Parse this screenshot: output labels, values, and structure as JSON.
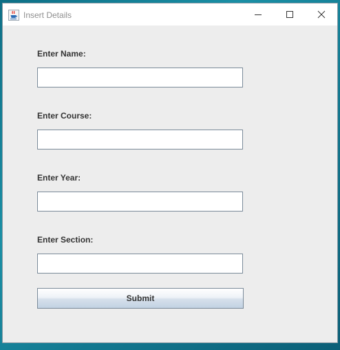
{
  "window": {
    "title": "Insert Details",
    "app_icon": "java-cup-icon",
    "controls": {
      "minimize_icon": "minimize-icon",
      "maximize_icon": "maximize-icon",
      "close_icon": "close-icon"
    }
  },
  "form": {
    "name_label": "Enter Name:",
    "name_value": "",
    "course_label": "Enter Course:",
    "course_value": "",
    "year_label": "Enter Year:",
    "year_value": "",
    "section_label": "Enter Section:",
    "section_value": "",
    "submit_label": "Submit"
  },
  "colors": {
    "window_background": "#ededed",
    "desktop_background": "#137a92",
    "field_border": "#7a8a99"
  }
}
